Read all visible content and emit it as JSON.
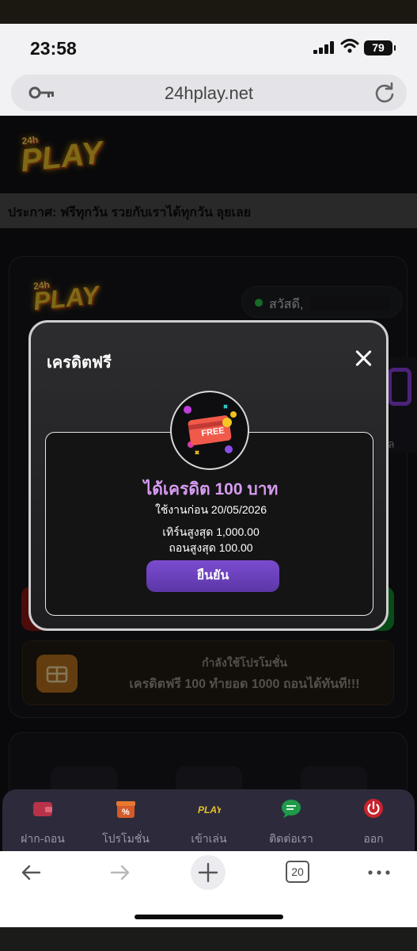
{
  "status_bar": {
    "time": "23:58",
    "battery": "79"
  },
  "browser": {
    "url": "24hplay.net",
    "tabs_count": "20"
  },
  "site": {
    "logo_text": "PLAY",
    "logo_number": "24h",
    "announcement": "ประกาศ:  ฟรีทุกวัน รวยกับเราได้ทุกวัน ลุยเลย",
    "greeting": "สวัสดี,",
    "peek_letter": "ล"
  },
  "promo": {
    "title": "กำลังใช้โปรโมชั่น",
    "description": "เครดิตฟรี 100 ทำยอด 1000 ถอนได้ทันที!!!"
  },
  "modal": {
    "title": "เครดิตฟรี",
    "badge_label": "FREE",
    "bonus_title": "ได้เครดิต 100 บาท",
    "use_before": "ใช้งานก่อน 20/05/2026",
    "max_turnover": "เทิร์นสูงสุด 1,000.00",
    "max_withdraw": "ถอนสูงสุด 100.00",
    "confirm_label": "ยืนยัน"
  },
  "bottom_nav": [
    {
      "label": "ฝาก-ถอน",
      "icon": "wallet-icon"
    },
    {
      "label": "โปรโมชั่น",
      "icon": "gift-percent-icon"
    },
    {
      "label": "เข้าเล่น",
      "icon": "play-logo-icon"
    },
    {
      "label": "ติดต่อเรา",
      "icon": "chat-icon"
    },
    {
      "label": "ออก",
      "icon": "power-icon"
    }
  ],
  "colors": {
    "accent_purple": "#d79bf0",
    "confirm_button": "#6a3fbd",
    "logo_gold": "#e8c02a",
    "online_dot": "#27c44a"
  }
}
